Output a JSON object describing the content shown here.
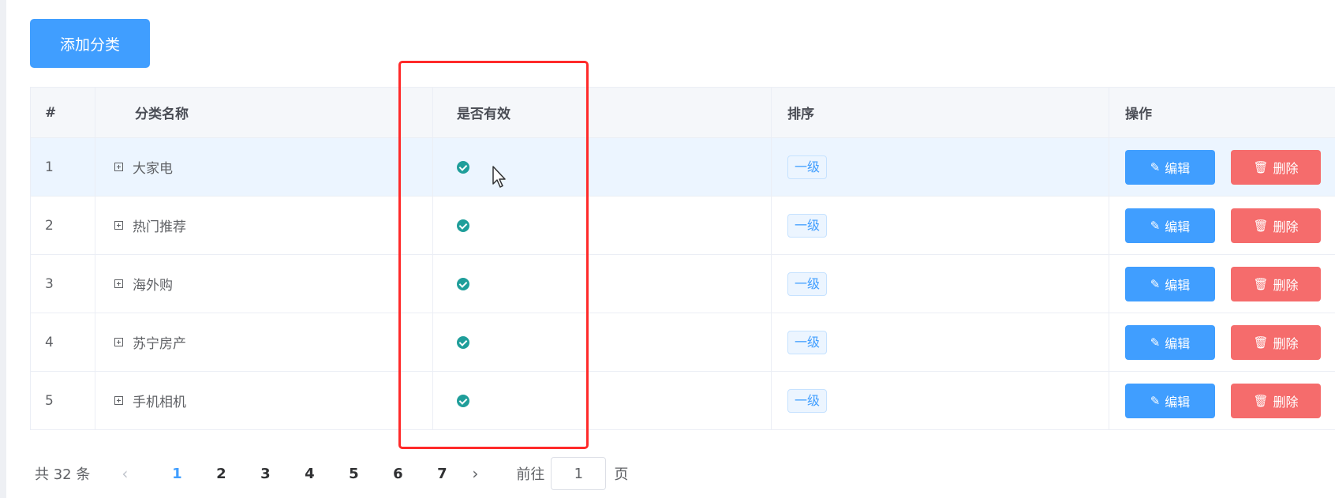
{
  "toolbar": {
    "add_label": "添加分类"
  },
  "table": {
    "headers": {
      "index": "#",
      "name": "分类名称",
      "valid": "是否有效",
      "sort": "排序",
      "ops": "操作"
    },
    "rows": [
      {
        "index": "1",
        "name": "大家电",
        "level": "一级",
        "valid": true
      },
      {
        "index": "2",
        "name": "热门推荐",
        "level": "一级",
        "valid": true
      },
      {
        "index": "3",
        "name": "海外购",
        "level": "一级",
        "valid": true
      },
      {
        "index": "4",
        "name": "苏宁房产",
        "level": "一级",
        "valid": true
      },
      {
        "index": "5",
        "name": "手机相机",
        "level": "一级",
        "valid": true
      }
    ],
    "edit_label": "编辑",
    "delete_label": "删除"
  },
  "pagination": {
    "total_text": "共 32 条",
    "prev": "‹",
    "next": "›",
    "pages": [
      "1",
      "2",
      "3",
      "4",
      "5",
      "6",
      "7"
    ],
    "current": "1",
    "goto_prefix": "前往",
    "goto_value": "1",
    "goto_suffix": "页"
  },
  "colors": {
    "primary": "#409eff",
    "danger": "#f56c6c",
    "valid": "#1f9e9a",
    "highlight": "#ff2a2a"
  },
  "icons": {
    "expand": "plus-square-icon",
    "valid": "check-circle-icon",
    "edit": "pencil-icon",
    "delete": "trash-icon"
  }
}
